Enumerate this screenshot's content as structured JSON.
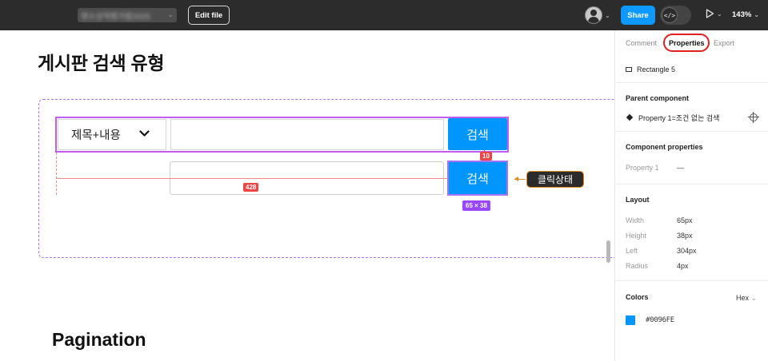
{
  "topbar": {
    "file_name": "명소성적평가발2025",
    "edit_file_label": "Edit file",
    "share_label": "Share",
    "dev_mode_glyph": "</>",
    "zoom_label": "143%"
  },
  "canvas": {
    "section1_title": "게시판 검색 유형",
    "select_label": "제목+내용",
    "search_button_label": "검색",
    "search_button_label_2": "검색",
    "spacing_measure": "10",
    "width_measure": "428",
    "size_badge": "65 × 38",
    "annotation_label": "클릭상태",
    "section2_title": "Pagination"
  },
  "panel": {
    "tabs": [
      {
        "label": "Comment"
      },
      {
        "label": "Properties",
        "active": true
      },
      {
        "label": "Export"
      }
    ],
    "layer_name": "Rectangle 5",
    "parent_component_title": "Parent component",
    "parent_component_value": "Property 1=조건 없는 검색",
    "component_properties_title": "Component properties",
    "component_property_label": "Property 1",
    "component_property_value": "—",
    "layout_title": "Layout",
    "layout_rows": [
      {
        "label": "Width",
        "value": "65px"
      },
      {
        "label": "Height",
        "value": "38px"
      },
      {
        "label": "Left",
        "value": "304px"
      },
      {
        "label": "Radius",
        "value": "4px"
      }
    ],
    "colors_title": "Colors",
    "color_format": "Hex",
    "color_value": "#0096FE"
  },
  "colors": {
    "accent": "#0d99ff",
    "search_button": "#0096fe",
    "component_outline": "#c15bf1",
    "frame_dashed": "#a872f7",
    "measure_red": "#ef4444",
    "size_badge": "#9747ff",
    "focus_ring": "#e21f1f"
  },
  "icons": [
    "chevron-down-icon",
    "avatar-icon",
    "code-icon",
    "play-icon",
    "rectangle-icon",
    "component-diamond-icon",
    "target-icon",
    "color-swatch-icon"
  ]
}
